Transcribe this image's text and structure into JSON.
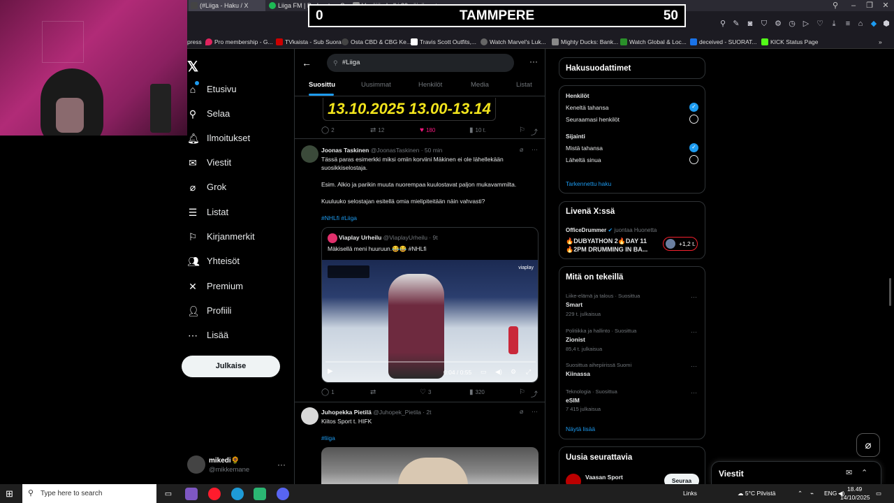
{
  "browser": {
    "tabs": [
      {
        "label": "(#Liiga - Haku / X",
        "color": "#333"
      },
      {
        "label": "Liiga FM | Podcast on Sp...",
        "color": "#1db954"
      },
      {
        "label": "Venäjän halki 30 päivässä - ...",
        "color": "#888"
      }
    ],
    "new_tab": "+",
    "bookmarks": [
      {
        "label": "press",
        "color": "#1c1b22"
      },
      {
        "label": "Pro membership - G...",
        "color": "#e0245e"
      },
      {
        "label": "TVkaista - Sub Suora",
        "color": "#c00"
      },
      {
        "label": "Osta CBD & CBG Ke...",
        "color": "#444"
      },
      {
        "label": "Travis Scott Outfits,...",
        "color": "#fff"
      },
      {
        "label": "Watch Marvel's Luk...",
        "color": "#666"
      },
      {
        "label": "Mighty Ducks: Bank...",
        "color": "#888"
      },
      {
        "label": "Watch Global & Loc...",
        "color": "#2a8f2a"
      },
      {
        "label": "deceived - SUORAT...",
        "color": "#1a73e8"
      },
      {
        "label": "KICK Status Page",
        "color": "#53fc18"
      }
    ]
  },
  "scoreboard": {
    "home_score": "0",
    "team": "TAMMPERE",
    "away_score": "50"
  },
  "nav": {
    "items": [
      {
        "label": "Etusivu",
        "icon": "⌂"
      },
      {
        "label": "Selaa",
        "icon": "⚲"
      },
      {
        "label": "Ilmoitukset",
        "icon": "🔔︎"
      },
      {
        "label": "Viestit",
        "icon": "✉"
      },
      {
        "label": "Grok",
        "icon": "⌀"
      },
      {
        "label": "Listat",
        "icon": "☰"
      },
      {
        "label": "Kirjanmerkit",
        "icon": "⚐"
      },
      {
        "label": "Yhteisöt",
        "icon": "👥︎"
      },
      {
        "label": "Premium",
        "icon": "✕"
      },
      {
        "label": "Profiili",
        "icon": "👤︎"
      },
      {
        "label": "Lisää",
        "icon": "⋯"
      }
    ],
    "post_button": "Julkaise",
    "account": {
      "name": "mikedi🌻",
      "handle": "@mikkemane"
    }
  },
  "search": {
    "query": "#Liiga"
  },
  "tabs": [
    "Suosittu",
    "Uusimmat",
    "Henkilöt",
    "Media",
    "Listat"
  ],
  "feed": {
    "top_banner_text": "13.10.2025 13.00-13.14",
    "top_actions": {
      "replies": "2",
      "reposts": "12",
      "likes": "180",
      "views": "10 t."
    },
    "tweet1": {
      "name": "Joonas Taskinen",
      "handle": "@JoonasTaskinen",
      "time": "· 50 min",
      "lines": [
        "Tässä paras esimerkki miksi omiin korviini Mäkinen ei ole lähellekään",
        "suosikkiselostaja.",
        "",
        "Esim. Alkio ja parikin muuta nuorempaa kuulostavat paljon mukavammilta.",
        "",
        "Kuuluuko selostajan esitellä omia mielipiteitään näin vahvasti?"
      ],
      "hashtags": "#NHLfi #Liiga",
      "quote": {
        "name": "Viaplay Urheilu",
        "handle": "@ViaplayUrheilu",
        "time": "· 9t",
        "text": "Mäkisellä meni huuruun.😂😂 #NHLfi",
        "video_time": "0:04 / 0:55",
        "video_logo": "viaplay"
      },
      "actions": {
        "replies": "1",
        "reposts": "",
        "likes": "3",
        "views": "320"
      }
    },
    "tweet2": {
      "name": "Juhopekka Pietilä",
      "handle": "@Juhopek_Pietila",
      "time": "· 2t",
      "text": "Kiitos Sport t. HIFK",
      "hashtag": "#liiga"
    }
  },
  "filters": {
    "title": "Hakusuodattimet",
    "people_title": "Henkilöt",
    "people_opts": [
      "Keneltä tahansa",
      "Seuraamasi henkilöt"
    ],
    "location_title": "Sijainti",
    "location_opts": [
      "Mistä tahansa",
      "Läheltä sinua"
    ],
    "advanced": "Tarkennettu haku"
  },
  "live": {
    "title": "Livenä X:ssä",
    "host": "OfficeDrummer",
    "host_suffix": "juontaa Huonetta",
    "line1": "🔥DUBYATHON 2🔥DAY 11",
    "line2": "🔥2PM DRUMMING IN BA...",
    "listeners": "+1,2 t."
  },
  "trends": {
    "title": "Mitä on tekeillä",
    "items": [
      {
        "meta": "Liike-elämä ja talous · Suosittua",
        "name": "Smart",
        "count": "229 t. julkaisua"
      },
      {
        "meta": "Politiikka ja hallinto · Suosittua",
        "name": "Zionist",
        "count": "85,4 t. julkaisua"
      },
      {
        "meta": "Suosittua aihepiirissä Suomi",
        "name": "Kiinassa",
        "count": ""
      },
      {
        "meta": "Teknologia · Suosittua",
        "name": "eSIM",
        "count": "7 415 julkaisua"
      }
    ],
    "show_more": "Näytä lisää"
  },
  "who_to_follow": {
    "title": "Uusia seurattavia",
    "name": "Vaasan Sport",
    "button": "Seuraa"
  },
  "messages_drawer": {
    "title": "Viestit"
  },
  "taskbar": {
    "search_placeholder": "Type here to search",
    "links": "Links",
    "weather": "5°C  Pilvistä",
    "lang": "ENG",
    "time": "18.49",
    "date": "14/10/2025"
  }
}
